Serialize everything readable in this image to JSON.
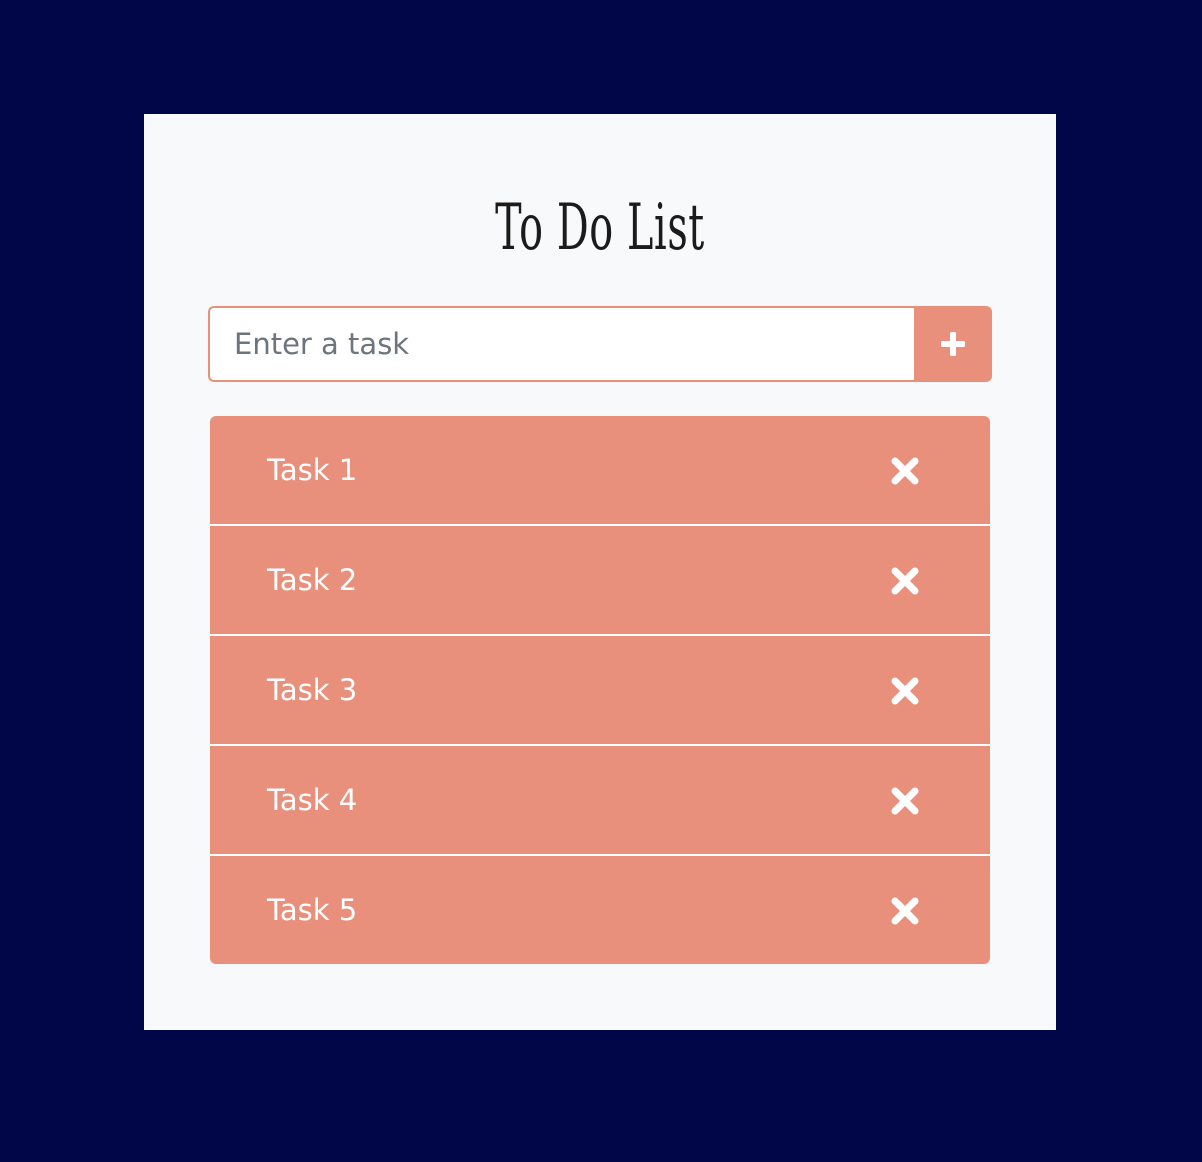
{
  "app": {
    "title": "To Do List"
  },
  "input": {
    "placeholder": "Enter a task",
    "value": "",
    "add_icon": "plus-icon"
  },
  "tasks": [
    {
      "label": "Task 1",
      "delete_icon": "close-icon"
    },
    {
      "label": "Task 2",
      "delete_icon": "close-icon"
    },
    {
      "label": "Task 3",
      "delete_icon": "close-icon"
    },
    {
      "label": "Task 4",
      "delete_icon": "close-icon"
    },
    {
      "label": "Task 5",
      "delete_icon": "close-icon"
    }
  ],
  "colors": {
    "page_background": "#000648",
    "card_background": "#f8f9fa",
    "accent": "#e8907c",
    "task_text": "#ffffff",
    "title_text": "#1b1b1b"
  }
}
